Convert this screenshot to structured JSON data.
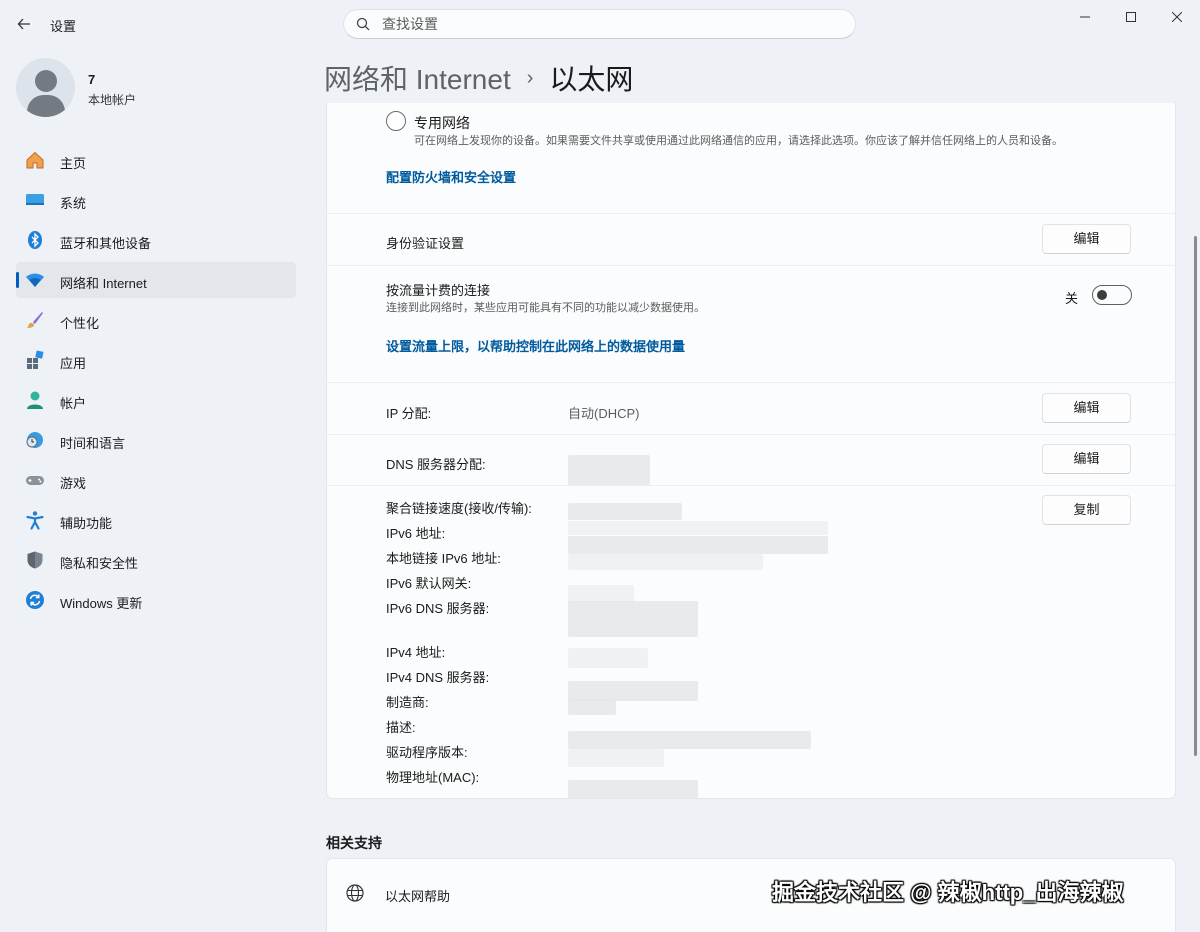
{
  "window": {
    "title": "设置",
    "search_placeholder": "查找设置"
  },
  "profile": {
    "name": "7",
    "account_type": "本地帐户"
  },
  "sidebar": {
    "items": [
      {
        "label": "主页",
        "icon": "home-icon"
      },
      {
        "label": "系统",
        "icon": "system-icon"
      },
      {
        "label": "蓝牙和其他设备",
        "icon": "bluetooth-icon"
      },
      {
        "label": "网络和 Internet",
        "icon": "wifi-icon",
        "active": true
      },
      {
        "label": "个性化",
        "icon": "brush-icon"
      },
      {
        "label": "应用",
        "icon": "apps-icon"
      },
      {
        "label": "帐户",
        "icon": "account-icon"
      },
      {
        "label": "时间和语言",
        "icon": "time-language-icon"
      },
      {
        "label": "游戏",
        "icon": "gamepad-icon"
      },
      {
        "label": "辅助功能",
        "icon": "accessibility-icon"
      },
      {
        "label": "隐私和安全性",
        "icon": "shield-icon"
      },
      {
        "label": "Windows 更新",
        "icon": "update-icon"
      }
    ]
  },
  "header": {
    "parent": "网络和 Internet",
    "separator": "›",
    "current": "以太网"
  },
  "network_profile": {
    "private_label": "专用网络",
    "private_desc": "可在网络上发现你的设备。如果需要文件共享或使用通过此网络通信的应用，请选择此选项。你应该了解并信任网络上的人员和设备。",
    "firewall_link": "配置防火墙和安全设置"
  },
  "auth": {
    "label": "身份验证设置",
    "button": "编辑"
  },
  "metered": {
    "label": "按流量计费的连接",
    "desc": "连接到此网络时，某些应用可能具有不同的功能以减少数据使用。",
    "toggle_state": "关",
    "toggle_on": false,
    "data_limit_link": "设置流量上限，以帮助控制在此网络上的数据使用量"
  },
  "ip": {
    "label": "IP 分配:",
    "value": "自动(DHCP)",
    "button": "编辑"
  },
  "dns": {
    "label": "DNS 服务器分配:",
    "button": "编辑"
  },
  "properties": {
    "copy_button": "复制",
    "labels": [
      "聚合链接速度(接收/传输):",
      "IPv6 地址:",
      "本地链接 IPv6 地址:",
      "IPv6 默认网关:",
      "IPv6 DNS 服务器:",
      "IPv4 地址:",
      "IPv4 DNS 服务器:",
      "制造商:",
      "描述:",
      "驱动程序版本:",
      "物理地址(MAC):"
    ]
  },
  "related": {
    "title": "相关支持",
    "items": [
      {
        "label": "以太网帮助",
        "icon": "globe-icon"
      }
    ]
  },
  "watermark": "掘金技术社区 @ 辣椒http_出海辣椒"
}
